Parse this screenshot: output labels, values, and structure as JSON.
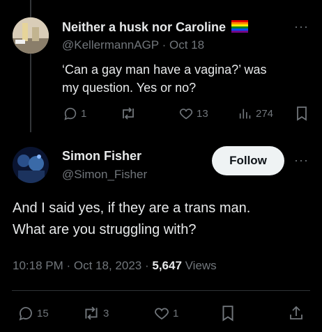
{
  "colors": {
    "background": "#000000",
    "text": "#e7e9ea",
    "muted": "#71767b",
    "border": "#2f3336",
    "follow_bg": "#eff3f4"
  },
  "reply_tweet": {
    "display_name": "Neither a husk nor Caroline",
    "flag_icon": "rainbow-flag-icon",
    "handle": "@KellermannAGP",
    "date": "Oct 18",
    "text_line1": "‘Can a gay man have a vagina?’ was",
    "text_line2": "my question. Yes or no?",
    "actions": {
      "replies": "1",
      "reposts": "",
      "likes": "13",
      "views": "274"
    }
  },
  "main_tweet": {
    "display_name": "Simon Fisher",
    "handle": "@Simon_Fisher",
    "follow_label": "Follow",
    "text_line1": "And I said yes, if they are a trans man.",
    "text_line2": "What are you struggling with?",
    "time": "10:18 PM",
    "date": "Oct 18, 2023",
    "views_count": "5,647",
    "views_label": "Views",
    "actions": {
      "replies": "15",
      "reposts": "3",
      "likes": "1"
    }
  }
}
